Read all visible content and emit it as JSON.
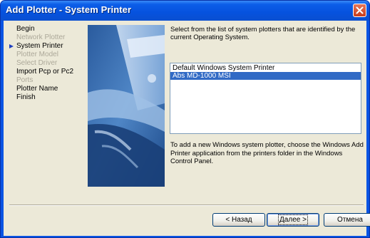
{
  "window": {
    "title": "Add Plotter - System Printer"
  },
  "steps": [
    {
      "label": "Begin",
      "state": "active"
    },
    {
      "label": "Network Plotter",
      "state": "disabled"
    },
    {
      "label": "System Printer",
      "state": "current"
    },
    {
      "label": "Plotter Model",
      "state": "disabled"
    },
    {
      "label": "Select Driver",
      "state": "disabled"
    },
    {
      "label": "Import Pcp or Pc2",
      "state": "active"
    },
    {
      "label": "Ports",
      "state": "disabled"
    },
    {
      "label": "Plotter Name",
      "state": "active"
    },
    {
      "label": "Finish",
      "state": "active"
    }
  ],
  "main": {
    "intro": "Select from the list of system plotters that are identified by the current Operating System.",
    "printers": [
      {
        "name": "Default Windows System Printer",
        "selected": false
      },
      {
        "name": "Abs MD-1000 MSI",
        "selected": true
      }
    ],
    "help": "To add a new Windows system plotter, choose the Windows Add Printer application from the printers folder in the Windows Control Panel."
  },
  "buttons": {
    "back": "< Назад",
    "next": "Далее >",
    "cancel": "Отмена"
  },
  "colors": {
    "titlebar": "#0652de",
    "selection": "#316ac5",
    "dialog_bg": "#ece9d8"
  }
}
